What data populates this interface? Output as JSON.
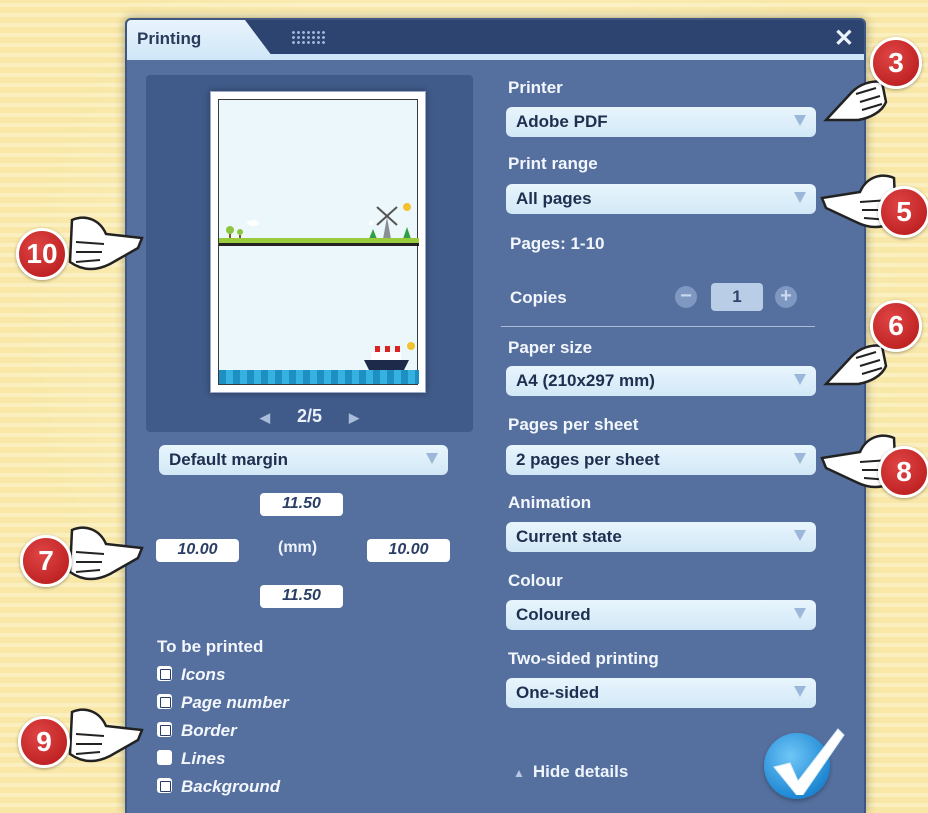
{
  "dialog": {
    "tab_title": "Printing",
    "close_glyph": "✕"
  },
  "preview": {
    "current_page": "2/5",
    "prev_glyph": "◀",
    "next_glyph": "▶"
  },
  "margins": {
    "preset": "Default margin",
    "top": "11.50",
    "left": "10.00",
    "right": "10.00",
    "bottom": "11.50",
    "unit": "(mm)"
  },
  "to_be_printed": {
    "heading": "To be printed",
    "items": [
      {
        "label": "Icons",
        "checked": false
      },
      {
        "label": "Page number",
        "checked": false
      },
      {
        "label": "Border",
        "checked": false
      },
      {
        "label": "Lines",
        "checked": true
      },
      {
        "label": "Background",
        "checked": false
      }
    ]
  },
  "settings": {
    "printer_label": "Printer",
    "printer_value": "Adobe PDF",
    "print_range_label": "Print range",
    "print_range_value": "All pages",
    "pages_info": "Pages: 1-10",
    "copies_label": "Copies",
    "copies_value": "1",
    "paper_size_label": "Paper size",
    "paper_size_value": "A4 (210x297 mm)",
    "pages_per_sheet_label": "Pages per sheet",
    "pages_per_sheet_value": "2 pages per sheet",
    "animation_label": "Animation",
    "animation_value": "Current state",
    "colour_label": "Colour",
    "colour_value": "Coloured",
    "two_sided_label": "Two-sided printing",
    "two_sided_value": "One-sided",
    "hide_details": "Hide details"
  },
  "callouts": [
    "3",
    "5",
    "6",
    "7",
    "8",
    "9",
    "10"
  ],
  "colors": {
    "dialog_bg": "#55709f",
    "titlebar": "#2d4470",
    "badge": "#c41f1f",
    "confirm": "#1f88d3"
  }
}
